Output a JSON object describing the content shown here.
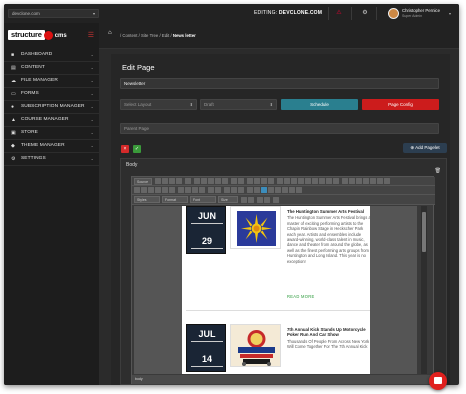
{
  "topbar": {
    "site": "devclone.com",
    "editing_label": "EDITING:",
    "editing_site": "DEVCLONE.COM",
    "user_name": "Christopher Pernice",
    "user_role": "Super Admin"
  },
  "sidebar": {
    "logo": "structure",
    "logo_suffix": "cms",
    "items": [
      {
        "label": "DASHBOARD",
        "icon": "dashboard-icon"
      },
      {
        "label": "CONTENT",
        "icon": "content-icon"
      },
      {
        "label": "FILE MANAGER",
        "icon": "cloud-icon"
      },
      {
        "label": "FORMS",
        "icon": "forms-icon"
      },
      {
        "label": "SUBSCRIPTION MANAGER",
        "icon": "subscription-icon"
      },
      {
        "label": "COURSE MANAGER",
        "icon": "course-icon"
      },
      {
        "label": "STORE",
        "icon": "cart-icon"
      },
      {
        "label": "THEME MANAGER",
        "icon": "theme-icon"
      },
      {
        "label": "SETTINGS",
        "icon": "gear-icon"
      }
    ]
  },
  "breadcrumb": {
    "items": [
      "Content",
      "Site Tree",
      "Edit"
    ],
    "current": "News letter"
  },
  "main": {
    "page_title": "Edit Page",
    "title_value": "Newsletter",
    "layout_placeholder": "Select Layout",
    "status_value": "Draft",
    "schedule_label": "Schedule",
    "page_config_label": "Page Config",
    "parent_page_placeholder": "Parent Page",
    "add_pagelet_label": "Add Pagelet",
    "body_label": "Body"
  },
  "editor": {
    "toolbar_row1": [
      "Source"
    ],
    "combos": [
      "Styles",
      "Format",
      "Font",
      "Size"
    ],
    "status": "body"
  },
  "events": [
    {
      "month": "JUN",
      "day": "29",
      "title": "The Huntington Summer Arts Festival",
      "description": "The Huntington Summer Arts Festival brings a master of exciting performing artists to the Chapin Rainbow Stage in Heckscher Park each year. Artists and ensembles include award-winning, world-class talent in music, dance and theater from around the globe, as well as the finest performing arts groups from Huntington and Long Island. This year is no exception!",
      "more": "READ MORE"
    },
    {
      "month": "JUL",
      "day": "14",
      "title": "7th Annual Kick Stands Up Motorcycle Poker Run And Car Show",
      "description": "Thousands Of People From Across New York Will Come Together For The 7th Annual Kick",
      "more": "READ MORE"
    }
  ],
  "colors": {
    "schedule": "#2a7f8f",
    "page_config": "#cc1c1c",
    "accent_red": "#d11",
    "read_more": "#2a9a3a"
  }
}
